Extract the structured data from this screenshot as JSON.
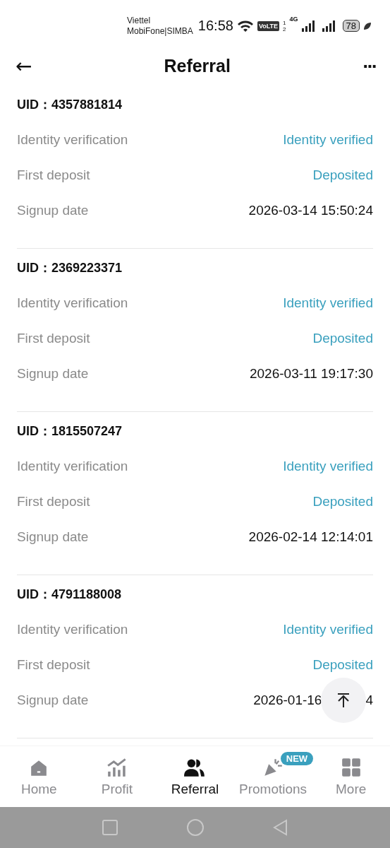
{
  "status_bar": {
    "carriers": [
      "Viettel",
      "MobiFone|SIMBA"
    ],
    "time": "16:58",
    "volte": "VoLTE",
    "sims": [
      "1",
      "2"
    ],
    "network": "4G",
    "battery": "78"
  },
  "header": {
    "title": "Referral",
    "back": "←",
    "more": "···"
  },
  "referrals": [
    {
      "uid_label": "UID：",
      "uid": "4357881814",
      "rows": [
        {
          "label": "Identity verification",
          "value": "Identity verified",
          "kind": "status"
        },
        {
          "label": "First deposit",
          "value": "Deposited",
          "kind": "status"
        },
        {
          "label": "Signup date",
          "value": "2026-03-14 15:50:24",
          "kind": "date"
        }
      ]
    },
    {
      "uid_label": "UID：",
      "uid": "2369223371",
      "rows": [
        {
          "label": "Identity verification",
          "value": "Identity verified",
          "kind": "status"
        },
        {
          "label": "First deposit",
          "value": "Deposited",
          "kind": "status"
        },
        {
          "label": "Signup date",
          "value": "2026-03-11 19:17:30",
          "kind": "date"
        }
      ]
    },
    {
      "uid_label": "UID：",
      "uid": "1815507247",
      "rows": [
        {
          "label": "Identity verification",
          "value": "Identity verified",
          "kind": "status"
        },
        {
          "label": "First deposit",
          "value": "Deposited",
          "kind": "status"
        },
        {
          "label": "Signup date",
          "value": "2026-02-14 12:14:01",
          "kind": "date"
        }
      ]
    },
    {
      "uid_label": "UID：",
      "uid": "4791188008",
      "rows": [
        {
          "label": "Identity verification",
          "value": "Identity verified",
          "kind": "status"
        },
        {
          "label": "First deposit",
          "value": "Deposited",
          "kind": "status"
        },
        {
          "label": "Signup date",
          "value": "2026-01-16",
          "tail": "4",
          "kind": "date"
        }
      ]
    }
  ],
  "nav": [
    {
      "label": "Home",
      "kind": "home",
      "selected": false
    },
    {
      "label": "Profit",
      "kind": "chart",
      "selected": false
    },
    {
      "label": "Referral",
      "kind": "people",
      "selected": true
    },
    {
      "label": "Promotions",
      "kind": "party",
      "selected": false,
      "badge": "NEW"
    },
    {
      "label": "More",
      "kind": "grid",
      "selected": false
    }
  ]
}
